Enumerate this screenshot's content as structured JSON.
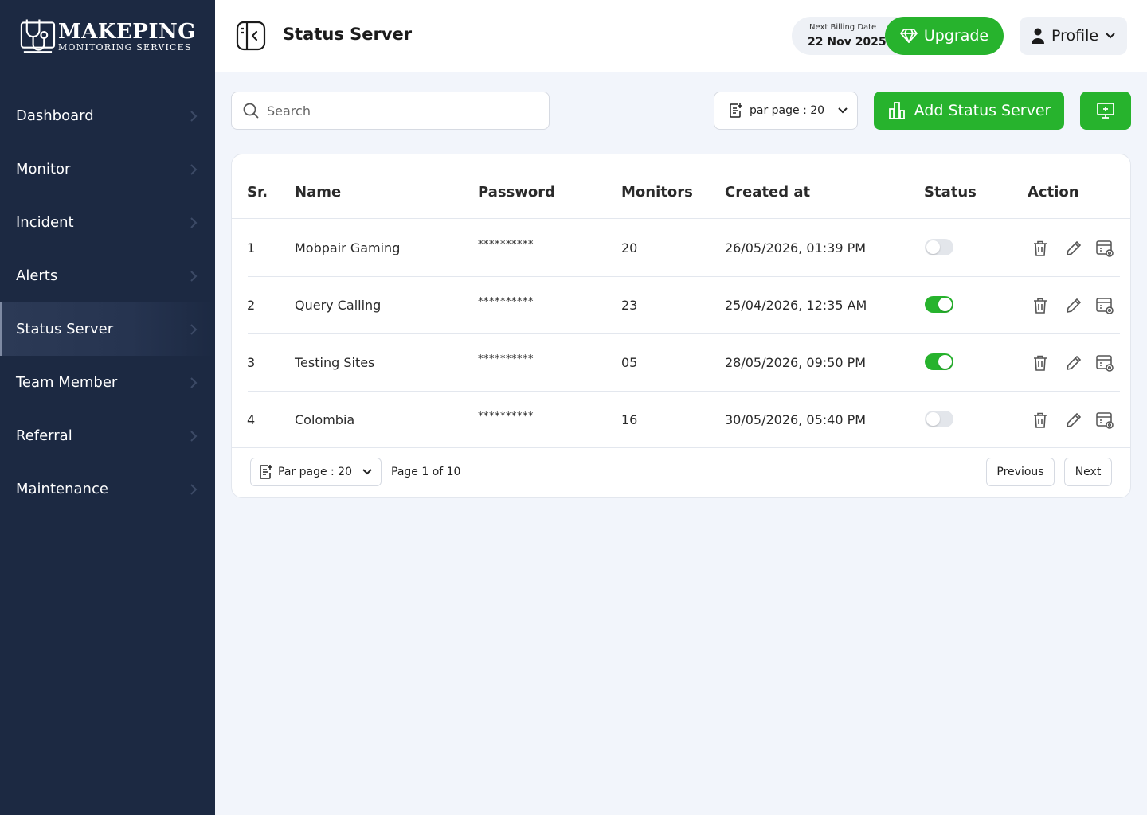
{
  "brand": {
    "title": "MAKEPING",
    "subtitle": "MONITORING SERVICES"
  },
  "sidebar": {
    "items": [
      {
        "label": "Dashboard",
        "active": false
      },
      {
        "label": "Monitor",
        "active": false
      },
      {
        "label": "Incident",
        "active": false
      },
      {
        "label": "Alerts",
        "active": false
      },
      {
        "label": "Status Server",
        "active": true
      },
      {
        "label": "Team Member",
        "active": false
      },
      {
        "label": "Referral",
        "active": false
      },
      {
        "label": "Maintenance",
        "active": false
      }
    ]
  },
  "header": {
    "title": "Status Server",
    "billing_label": "Next Billing Date",
    "billing_date": "22 Nov 2025",
    "upgrade_label": "Upgrade",
    "profile_label": "Profile"
  },
  "toolbar": {
    "search_placeholder": "Search",
    "per_page_label": "par page : 20",
    "add_label": "Add  Status Server"
  },
  "table": {
    "headers": {
      "sr": "Sr.",
      "name": "Name",
      "password": "Password",
      "monitors": "Monitors",
      "created": "Created at",
      "status": "Status",
      "action": "Action"
    },
    "rows": [
      {
        "sr": "1",
        "name": "Mobpair Gaming",
        "password": "**********",
        "monitors": "20",
        "created": "26/05/2026, 01:39 PM",
        "status_on": false
      },
      {
        "sr": "2",
        "name": "Query Calling",
        "password": "**********",
        "monitors": "23",
        "created": "25/04/2026, 12:35 AM",
        "status_on": true
      },
      {
        "sr": "3",
        "name": "Testing Sites",
        "password": "**********",
        "monitors": "05",
        "created": "28/05/2026, 09:50 PM",
        "status_on": true
      },
      {
        "sr": "4",
        "name": "Colombia",
        "password": "**********",
        "monitors": "16",
        "created": "30/05/2026, 05:40 PM",
        "status_on": false
      }
    ]
  },
  "footer": {
    "per_page_label": "Par page : 20",
    "page_info": "Page 1 of 10",
    "previous_label": "Previous",
    "next_label": "Next"
  },
  "colors": {
    "sidebar_bg": "#1C2942",
    "accent_green": "#27B32D",
    "page_bg": "#F2F5FB"
  }
}
